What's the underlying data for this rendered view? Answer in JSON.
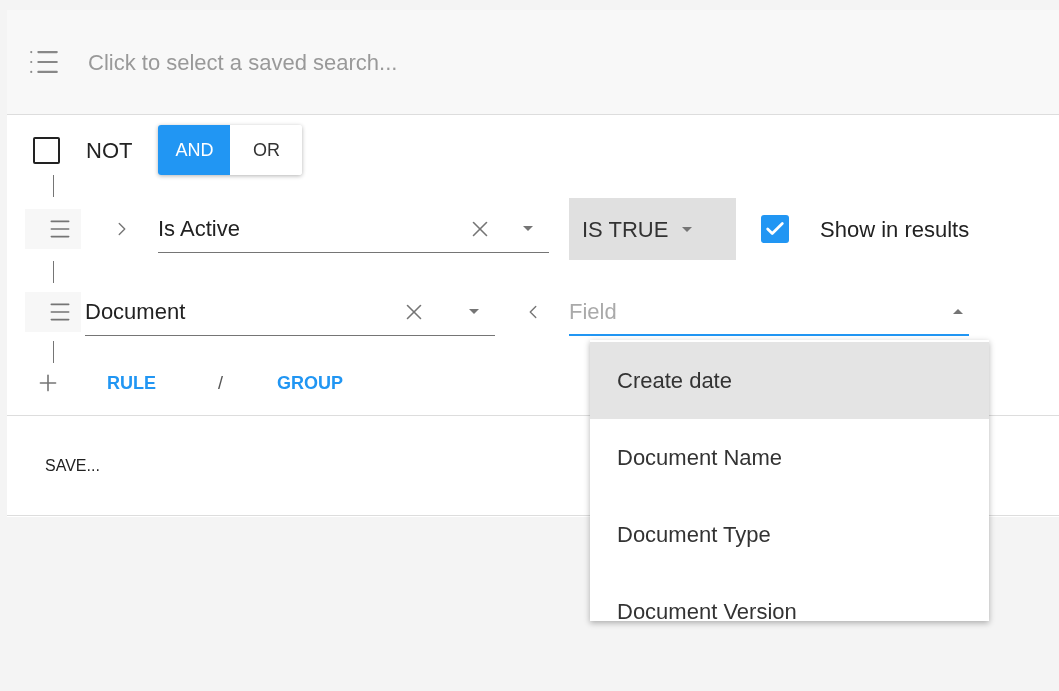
{
  "saved_search": {
    "placeholder": "Click to select a saved search..."
  },
  "group": {
    "not_label": "NOT",
    "not_checked": false,
    "combinators": [
      {
        "label": "AND",
        "selected": true
      },
      {
        "label": "OR",
        "selected": false
      }
    ]
  },
  "rules": [
    {
      "kind": "boolean",
      "expanded": false,
      "field": "Is Active",
      "operator": "IS TRUE",
      "show_in_results": {
        "label": "Show in results",
        "checked": true
      }
    },
    {
      "kind": "relation",
      "expanded": true,
      "field": "Document",
      "subfield": {
        "placeholder": "Field",
        "open": true,
        "options": [
          {
            "label": "Create date",
            "selected": true
          },
          {
            "label": "Document Name",
            "selected": false
          },
          {
            "label": "Document Type",
            "selected": false
          },
          {
            "label": "Document Version",
            "selected": false
          }
        ]
      }
    }
  ],
  "add": {
    "rule": "RULE",
    "separator": "/",
    "group": "GROUP"
  },
  "save": "SAVE..."
}
